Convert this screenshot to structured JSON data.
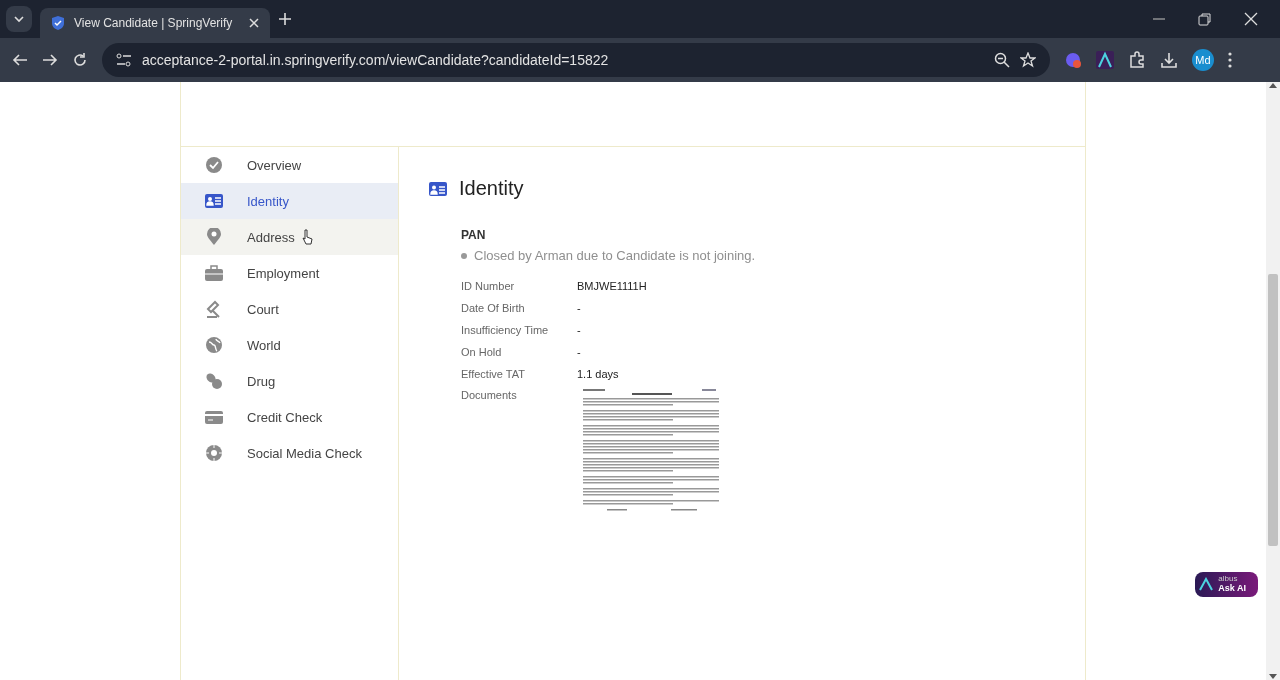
{
  "browser": {
    "tab_title": "View Candidate | SpringVerify",
    "url": "acceptance-2-portal.in.springverify.com/viewCandidate?candidateId=15822",
    "profile": "Md"
  },
  "sidebar": {
    "items": [
      {
        "label": "Overview",
        "selected": false,
        "hovered": false
      },
      {
        "label": "Identity",
        "selected": true,
        "hovered": false
      },
      {
        "label": "Address",
        "selected": false,
        "hovered": true
      },
      {
        "label": "Employment",
        "selected": false,
        "hovered": false
      },
      {
        "label": "Court",
        "selected": false,
        "hovered": false
      },
      {
        "label": "World",
        "selected": false,
        "hovered": false
      },
      {
        "label": "Drug",
        "selected": false,
        "hovered": false
      },
      {
        "label": "Credit Check",
        "selected": false,
        "hovered": false
      },
      {
        "label": "Social Media Check",
        "selected": false,
        "hovered": false
      }
    ]
  },
  "section": {
    "title": "Identity",
    "check": "PAN",
    "status": "Closed by Arman due to Candidate is not joining.",
    "fields": [
      {
        "label": "ID Number",
        "value": "BMJWE1111H"
      },
      {
        "label": "Date Of Birth",
        "value": "-"
      },
      {
        "label": "Insufficiency Time",
        "value": "-"
      },
      {
        "label": "On Hold",
        "value": "-"
      },
      {
        "label": "Effective TAT",
        "value": "1.1 days"
      }
    ],
    "documents_label": "Documents"
  },
  "ask_ai": {
    "brand": "albus",
    "label": "Ask AI"
  }
}
